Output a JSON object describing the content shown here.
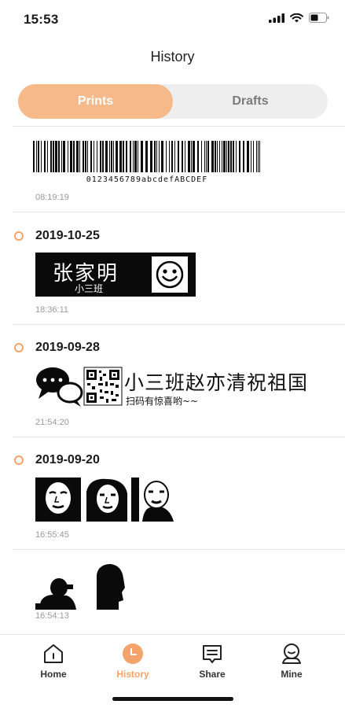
{
  "status_bar": {
    "time": "15:53"
  },
  "header": {
    "title": "History"
  },
  "segments": {
    "prints": "Prints",
    "drafts": "Drafts",
    "active": "prints"
  },
  "entries": [
    {
      "date": "",
      "time": "08:19:19",
      "barcode_text": "0123456789abcdefABCDEF"
    },
    {
      "date": "2019-10-25",
      "time": "18:36:11",
      "label_name": "张家明",
      "label_class": "小三班"
    },
    {
      "date": "2019-09-28",
      "time": "21:54:20",
      "title_text": "小三班赵亦清祝祖国",
      "sub_text": "扫码有惊喜哟~~"
    },
    {
      "date": "2019-09-20",
      "time": "16:55:45"
    },
    {
      "date": "",
      "time": "16:54:13"
    }
  ],
  "tabbar": {
    "items": [
      {
        "label": "Home",
        "icon": "home-icon"
      },
      {
        "label": "History",
        "icon": "history-icon"
      },
      {
        "label": "Share",
        "icon": "share-icon"
      },
      {
        "label": "Mine",
        "icon": "mine-icon"
      }
    ],
    "active": "History"
  },
  "colors": {
    "accent": "#f5b98a",
    "accent_strong": "#f4a36a",
    "segment_bg": "#eeeeee",
    "label_black": "#0a0a0a"
  }
}
